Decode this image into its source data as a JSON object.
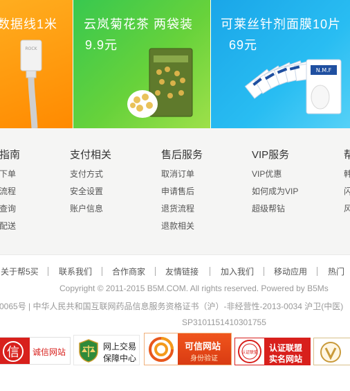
{
  "banners": [
    {
      "title": "数据线1米"
    },
    {
      "title": "云岚菊花茶 两袋装",
      "price": "9.9元"
    },
    {
      "title": "可莱丝针剂面膜10片",
      "price": "69元"
    }
  ],
  "help_columns": [
    {
      "title": "指南",
      "items": [
        "下单",
        "流程",
        "查询",
        "配送"
      ]
    },
    {
      "title": "支付相关",
      "items": [
        "支付方式",
        "安全设置",
        "账户信息"
      ]
    },
    {
      "title": "售后服务",
      "items": [
        "取消订单",
        "申请售后",
        "退货流程",
        "退款相关"
      ]
    },
    {
      "title": "VIP服务",
      "items": [
        "VIP优惠",
        "如何成为VIP",
        "超级帮钻"
      ]
    },
    {
      "title": "帮",
      "items": [
        "韩",
        "闪",
        "风"
      ]
    }
  ],
  "footer": {
    "links": [
      "关于帮5买",
      "联系我们",
      "合作商家",
      "友情链接",
      "加入我们",
      "移动应用",
      "热门"
    ],
    "copyright": "Copyright © 2011-2015 B5M.COM. All rights reserved. Powered by B5Ms",
    "license": "0065号 | 中华人民共和国互联网药品信息服务资格证书（沪）-非经营性-2013-0034 沪卫(中医)",
    "record": "SP3101151410301755"
  },
  "badges": [
    {
      "icon": "xin-icon",
      "text": "诚信网站",
      "glyph": "信"
    },
    {
      "icon": "scale-shield-icon",
      "line1": "网上交易",
      "line2": "保障中心"
    },
    {
      "icon": "trusted-site-icon",
      "line1": "可信网站",
      "line2": "身份验证"
    },
    {
      "icon": "alliance-seal-icon",
      "line1": "认证联盟",
      "line2": "实名网站",
      "seal": "认证联盟"
    },
    {
      "icon": "v-shield-icon"
    }
  ],
  "colors": {
    "orange": "#ff9a14",
    "green": "#4ecc43",
    "blue": "#27b8f0",
    "badge_red": "#d8201c"
  }
}
